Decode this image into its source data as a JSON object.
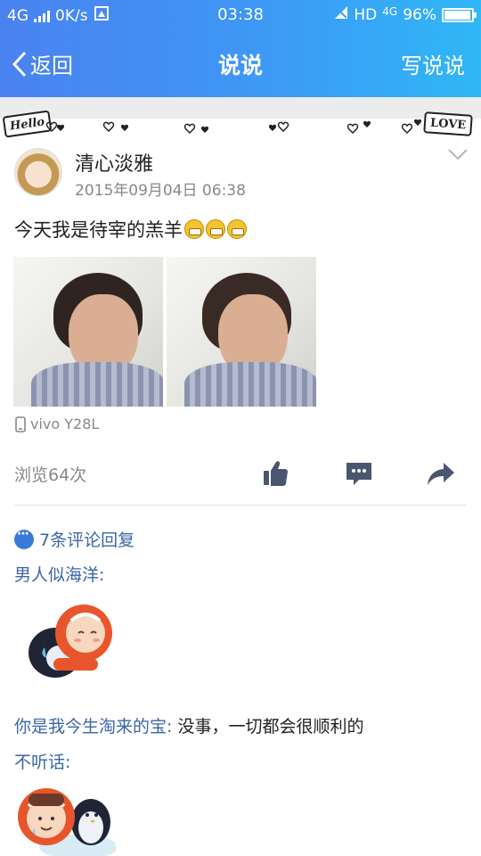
{
  "status_bar": {
    "network": "4G",
    "speed": "0K/s",
    "time": "03:38",
    "hd_label": "HD",
    "network_right": "4G",
    "battery_level": 0.96,
    "battery_text": "96%"
  },
  "navbar": {
    "back_label": "返回",
    "title": "说说",
    "write_label": "写说说"
  },
  "doodle": {
    "left_tag": "Hello",
    "right_tag": "LOVE"
  },
  "post": {
    "username": "清心淡雅",
    "timestamp": "2015年09月04日 06:38",
    "text": "今天我是待宰的羔羊",
    "emoji_icons": [
      "grin-emoji-icon",
      "grin-emoji-icon",
      "grin-emoji-icon"
    ],
    "device": "vivo Y28L",
    "views": "浏览64次"
  },
  "comments": {
    "count_label": "7条评论回复",
    "items": [
      {
        "name": "男人似海洋:",
        "text": "",
        "has_sticker": true
      },
      {
        "name": "你是我今生淘来的宝:",
        "text": " 没事，一切都会很顺利的"
      },
      {
        "name": "不听话:",
        "text": "",
        "has_sticker": true
      }
    ]
  },
  "colors": {
    "nav_gradient_start": "#4a82f0",
    "nav_gradient_end": "#2fb7f6",
    "comment_name": "#3a66a8",
    "icon_dark": "#4a5670"
  }
}
